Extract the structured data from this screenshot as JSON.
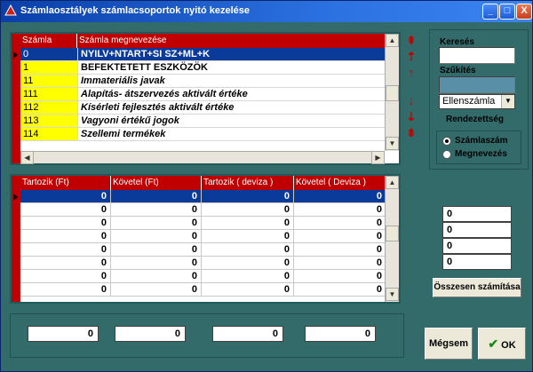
{
  "window": {
    "title": "Számlaosztályek  számlacsoportok nyitó kezelése"
  },
  "accounts_grid": {
    "columns": [
      "Számla",
      "Számla megnevezése"
    ],
    "rows": [
      {
        "code": "0",
        "name": "NYILV+NTART+SI SZ+ML+K"
      },
      {
        "code": "1",
        "name": "BEFEKTETETT ESZKÖZÖK"
      },
      {
        "code": "11",
        "name": "Immateriális javak"
      },
      {
        "code": "111",
        "name": "Alapítás- átszervezés aktivált értéke"
      },
      {
        "code": "112",
        "name": "Kísérleti fejlesztés aktivált értéke"
      },
      {
        "code": "113",
        "name": "Vagyoni értékű jogok"
      },
      {
        "code": "114",
        "name": "Szellemi termékek"
      }
    ]
  },
  "balance_grid": {
    "columns": [
      "Tartozik (Ft)",
      "Követel (Ft)",
      "Tartozik ( deviza )",
      "Követel ( Deviza )"
    ],
    "rows": [
      [
        "0",
        "0",
        "0",
        "0"
      ],
      [
        "0",
        "0",
        "0",
        "0"
      ],
      [
        "0",
        "0",
        "0",
        "0"
      ],
      [
        "0",
        "0",
        "0",
        "0"
      ],
      [
        "0",
        "0",
        "0",
        "0"
      ],
      [
        "0",
        "0",
        "0",
        "0"
      ],
      [
        "0",
        "0",
        "0",
        "0"
      ],
      [
        "0",
        "0",
        "0",
        "0"
      ]
    ]
  },
  "filter": {
    "search_label": "Keresés",
    "search_value": "",
    "narrow_label": "Szűkítés",
    "narrow_value": "",
    "narrow_combo_value": "Ellenszámla"
  },
  "sort": {
    "label": "Rendezettség",
    "options": [
      "Számlaszám",
      "Megnevezés"
    ],
    "selected": "Számlaszám"
  },
  "totals": {
    "values": [
      "0",
      "0",
      "0",
      "0"
    ],
    "button": "Összesen számítása"
  },
  "bottom_totals": [
    "0",
    "0",
    "0",
    "0"
  ],
  "buttons": {
    "cancel": "Mégsem",
    "ok": "OK"
  },
  "titlebar_buttons": {
    "minimize": "_",
    "maximize": "□",
    "close": "X"
  },
  "colors": {
    "background": "#336b6b",
    "header": "#c00000",
    "selection": "#0a3a9a",
    "code_cell": "#ffff00"
  }
}
